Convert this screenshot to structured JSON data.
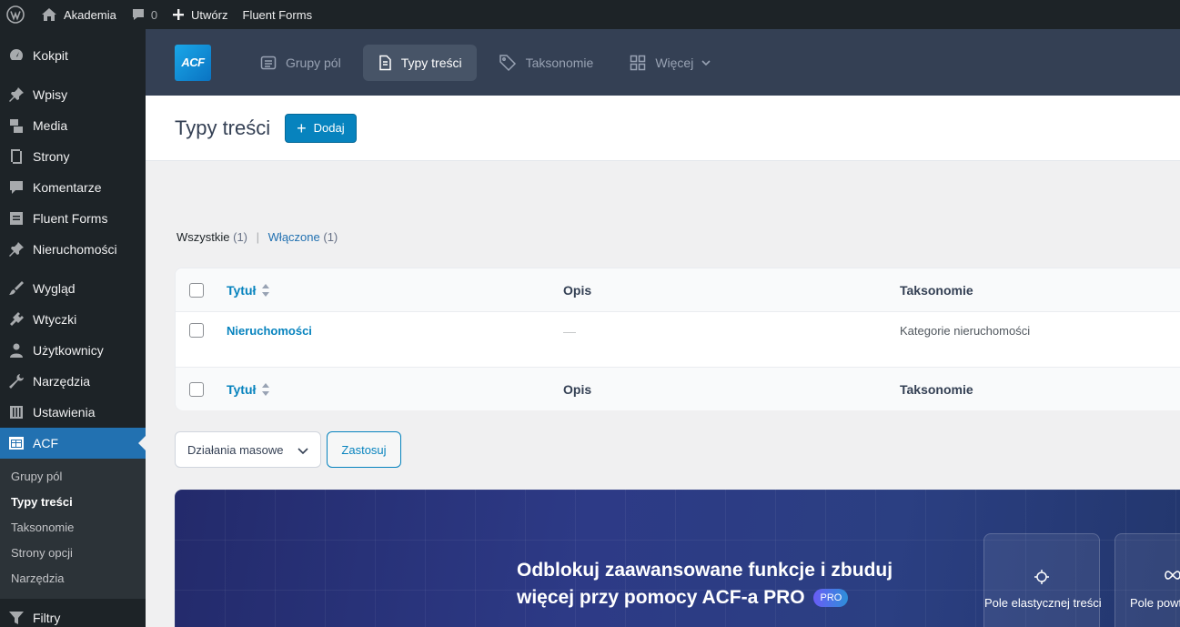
{
  "admin_bar": {
    "site_name": "Akademia",
    "comments_count": "0",
    "new_label": "Utwórz",
    "fluent_forms": "Fluent Forms"
  },
  "sidebar": {
    "items": [
      {
        "label": "Kokpit",
        "icon": "dashboard-icon"
      },
      {
        "label": "Wpisy",
        "icon": "pin-icon"
      },
      {
        "label": "Media",
        "icon": "media-icon"
      },
      {
        "label": "Strony",
        "icon": "pages-icon"
      },
      {
        "label": "Komentarze",
        "icon": "comments-icon"
      },
      {
        "label": "Fluent Forms",
        "icon": "forms-icon"
      },
      {
        "label": "Nieruchomości",
        "icon": "pin-icon"
      },
      {
        "label": "Wygląd",
        "icon": "appearance-icon"
      },
      {
        "label": "Wtyczki",
        "icon": "plugins-icon"
      },
      {
        "label": "Użytkownicy",
        "icon": "users-icon"
      },
      {
        "label": "Narzędzia",
        "icon": "tools-icon"
      },
      {
        "label": "Ustawienia",
        "icon": "settings-icon"
      },
      {
        "label": "ACF",
        "icon": "acf-icon"
      },
      {
        "label": "Filtry",
        "icon": "filter-icon"
      }
    ],
    "acf_submenu": [
      "Grupy pól",
      "Typy treści",
      "Taksonomie",
      "Strony opcji",
      "Narzędzia"
    ]
  },
  "acf_header": {
    "logo_text": "ACF",
    "tabs": [
      {
        "label": "Grupy pól",
        "icon": "field-groups-icon"
      },
      {
        "label": "Typy treści",
        "icon": "post-types-icon"
      },
      {
        "label": "Taksonomie",
        "icon": "taxonomies-icon"
      },
      {
        "label": "Więcej",
        "icon": "more-grid-icon"
      }
    ],
    "active_tab": "Typy treści"
  },
  "page": {
    "title": "Typy treści",
    "add_button": "Dodaj"
  },
  "filters": {
    "all_label": "Wszystkie",
    "all_count": "(1)",
    "enabled_label": "Włączone",
    "enabled_count": "(1)"
  },
  "table": {
    "columns": [
      "Tytuł",
      "Opis",
      "Taksonomie"
    ],
    "rows": [
      {
        "title": "Nieruchomości",
        "description": "—",
        "taxonomies": "Kategorie nieruchomości"
      }
    ]
  },
  "bulk": {
    "select_value": "Działania masowe",
    "apply_label": "Zastosuj"
  },
  "promo": {
    "heading_line1": "Odblokuj zaawansowane funkcje i zbuduj",
    "heading_line2": "więcej przy pomocy ACF-a PRO",
    "badge": "PRO",
    "features": [
      "Pole elastycznej treści",
      "Pole powta"
    ]
  },
  "colors": {
    "admin_dark": "#1d2327",
    "wp_blue": "#2271b1",
    "acf_header": "#344054",
    "acf_blue": "#0783be"
  }
}
